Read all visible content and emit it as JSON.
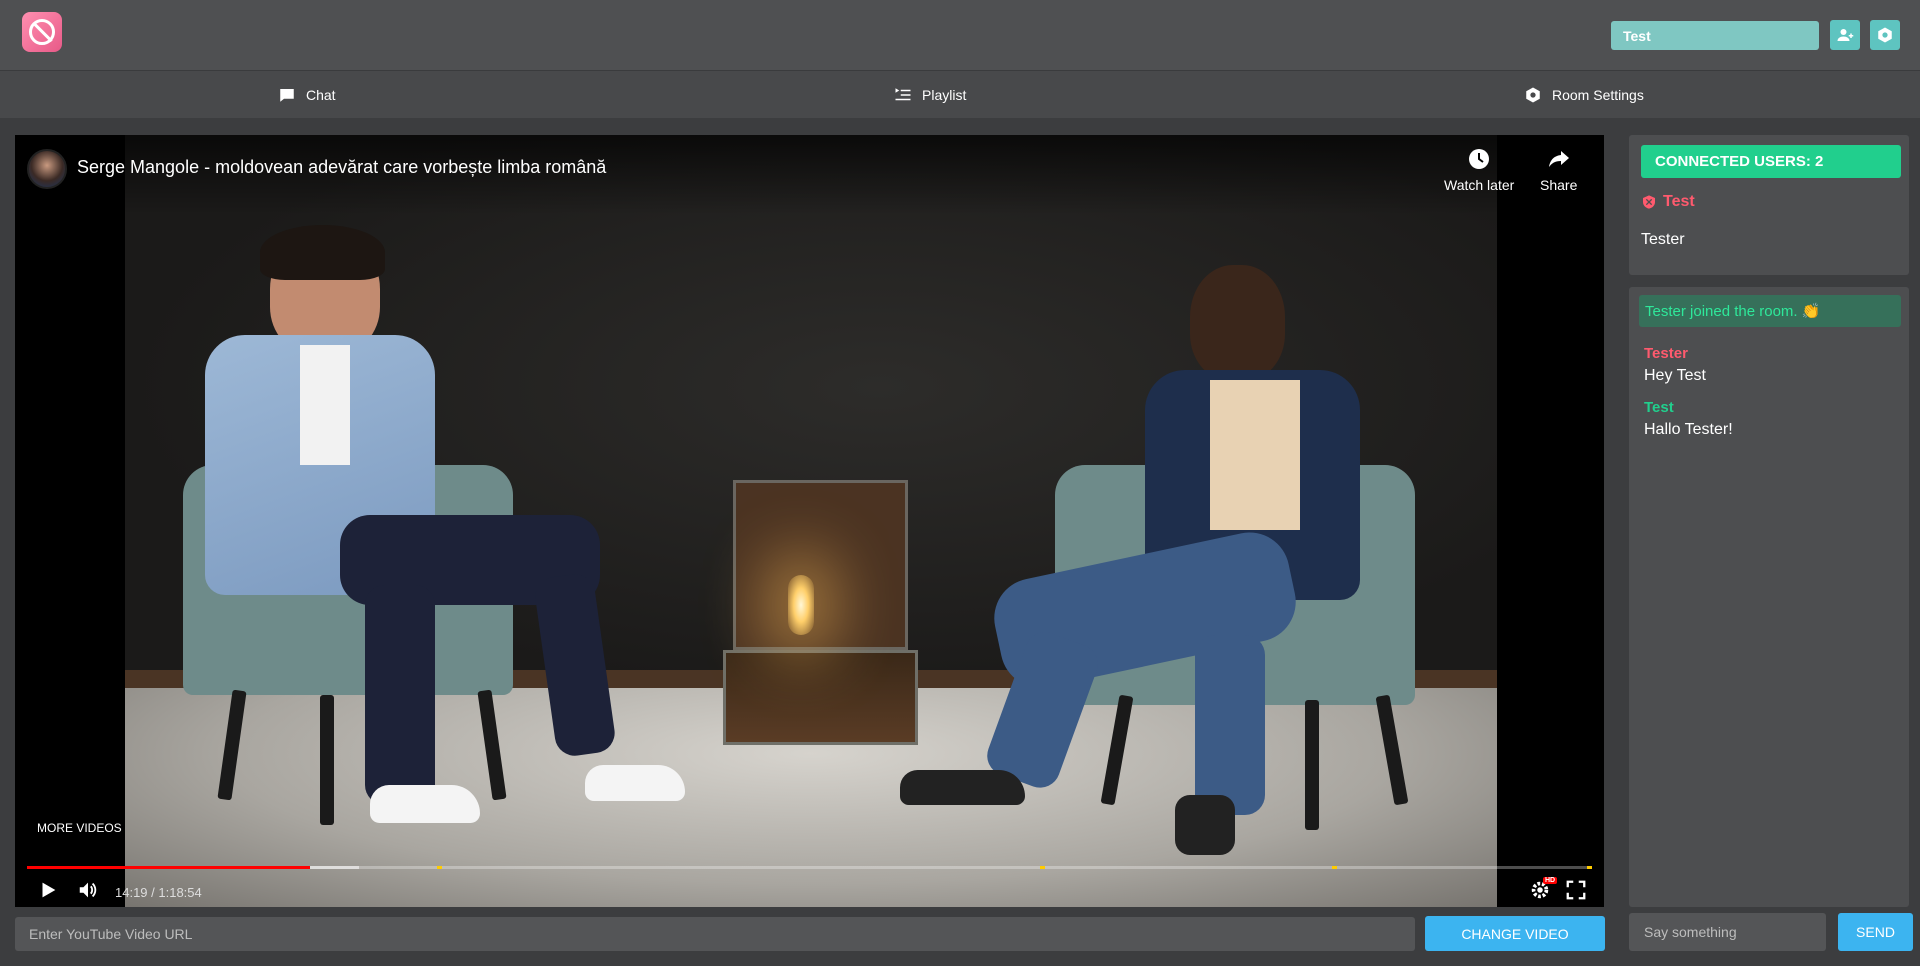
{
  "header": {
    "logo_icon": "logo-icon",
    "username_value": "Test",
    "buttons": [
      {
        "icon": "add-user-icon"
      },
      {
        "icon": "settings-hexagon-icon"
      }
    ]
  },
  "nav": {
    "tabs": [
      {
        "label": "Chat",
        "icon": "chat-icon"
      },
      {
        "label": "Playlist",
        "icon": "playlist-icon"
      },
      {
        "label": "Room Settings",
        "icon": "settings-hexagon-icon"
      }
    ]
  },
  "video": {
    "title": "Serge Mangole - moldovean adevărat care vorbește limba română",
    "watch_later_label": "Watch later",
    "share_label": "Share",
    "more_videos_label": "MORE VIDEOS",
    "time_display": "14:19 / 1:18:54",
    "progress_played_fraction": 0.181,
    "progress_loaded_fraction": 0.212,
    "hd_badge": "HD"
  },
  "url_bar": {
    "placeholder": "Enter YouTube Video URL",
    "button_label": "CHANGE VIDEO"
  },
  "users": {
    "connected_label": "CONNECTED USERS: 2",
    "list": [
      {
        "name": "Test",
        "role": "admin"
      },
      {
        "name": "Tester",
        "role": "user"
      }
    ]
  },
  "chat": {
    "system_message": "Tester joined the room. 👏",
    "messages": [
      {
        "author": "Tester",
        "text": "Hey Test"
      },
      {
        "author": "Test",
        "text": "Hallo Tester!"
      }
    ],
    "input_placeholder": "Say something",
    "send_label": "SEND"
  },
  "colors": {
    "accent_teal": "#5ec4c0",
    "accent_blue": "#3cb4f0",
    "success_green": "#21cf8d",
    "admin_red": "#ff5a6e",
    "chat_green": "#2ee89a"
  }
}
